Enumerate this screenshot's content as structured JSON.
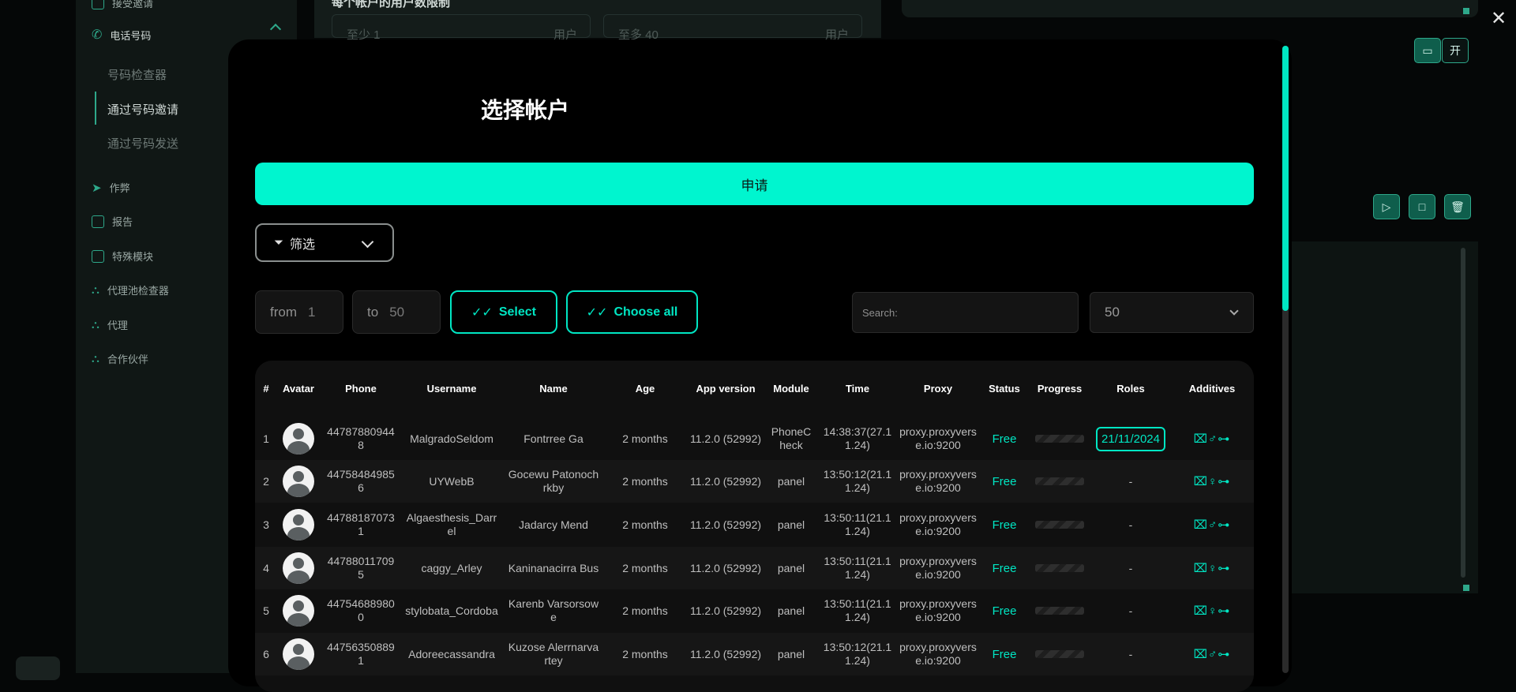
{
  "sidebar": {
    "top_item": "接受邀请",
    "phone_section": "电话号码",
    "sub_items": [
      "号码检查器",
      "通过号码邀请",
      "通过号码发送"
    ],
    "items": [
      "作弊",
      "报告",
      "特殊模块",
      "代理池检查器",
      "代理",
      "合作伙伴"
    ]
  },
  "background": {
    "header_text": "每个帐户的用户数限制",
    "min_placeholder": "至少 1",
    "max_placeholder": "至多 40",
    "unit": "用户",
    "open_button": "开"
  },
  "modal": {
    "title": "选择帐户",
    "apply_label": "申请",
    "filter_label": "筛选",
    "from_label": "from",
    "from_value": "1",
    "to_label": "to",
    "to_value": "50",
    "select_label": "Select",
    "choose_all_label": "Choose all",
    "search_placeholder": "Search:",
    "per_page": "50"
  },
  "table": {
    "columns": [
      "#",
      "Avatar",
      "Phone",
      "Username",
      "Name",
      "Age",
      "App version",
      "Module",
      "Time",
      "Proxy",
      "Status",
      "Progress",
      "Roles",
      "Additives"
    ],
    "rows": [
      {
        "num": "1",
        "phone": "447878809448",
        "username": "MalgradoSeldom",
        "name": "Fontrree Ga",
        "age": "2 months",
        "app": "11.2.0 (52992)",
        "module": "PhoneCheck",
        "time": "14:38:37(27.11.24)",
        "proxy": "proxy.proxyverse.io:9200",
        "status": "Free",
        "roles": "21/11/2024",
        "additives": "⌧♂⊶"
      },
      {
        "num": "2",
        "phone": "447584849856",
        "username": "UYWebB",
        "name": "Gocewu Patonochrkby",
        "age": "2 months",
        "app": "11.2.0 (52992)",
        "module": "panel",
        "time": "13:50:12(21.11.24)",
        "proxy": "proxy.proxyverse.io:9200",
        "status": "Free",
        "roles": "-",
        "additives": "⌧♀⊶"
      },
      {
        "num": "3",
        "phone": "447881870731",
        "username": "Algaesthesis_Darrel",
        "name": "Jadarcy Mend",
        "age": "2 months",
        "app": "11.2.0 (52992)",
        "module": "panel",
        "time": "13:50:11(21.11.24)",
        "proxy": "proxy.proxyverse.io:9200",
        "status": "Free",
        "roles": "-",
        "additives": "⌧♂⊶"
      },
      {
        "num": "4",
        "phone": "447880117095",
        "username": "caggy_Arley",
        "name": "Kaninanacirra Bus",
        "age": "2 months",
        "app": "11.2.0 (52992)",
        "module": "panel",
        "time": "13:50:11(21.11.24)",
        "proxy": "proxy.proxyverse.io:9200",
        "status": "Free",
        "roles": "-",
        "additives": "⌧♀⊶"
      },
      {
        "num": "5",
        "phone": "447546889800",
        "username": "stylobata_Cordoba",
        "name": "Karenb Varsorsowe",
        "age": "2 months",
        "app": "11.2.0 (52992)",
        "module": "panel",
        "time": "13:50:11(21.11.24)",
        "proxy": "proxy.proxyverse.io:9200",
        "status": "Free",
        "roles": "-",
        "additives": "⌧♀⊶"
      },
      {
        "num": "6",
        "phone": "447563508891",
        "username": "Adoreecassandra",
        "name": "Kuzose Alerrnarvartey",
        "age": "2 months",
        "app": "11.2.0 (52992)",
        "module": "panel",
        "time": "13:50:12(21.11.24)",
        "proxy": "proxy.proxyverse.io:9200",
        "status": "Free",
        "roles": "-",
        "additives": "⌧♂⊶"
      }
    ]
  }
}
